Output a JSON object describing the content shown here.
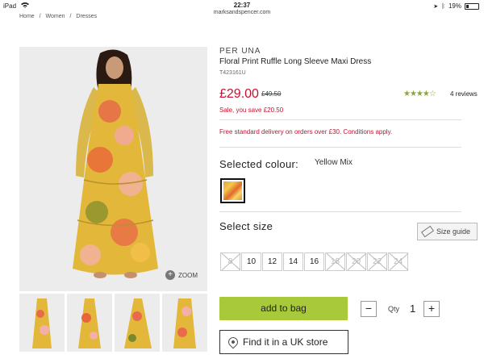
{
  "status_bar": {
    "device": "iPad",
    "time": "22:37",
    "url": "marksandspencer.com",
    "battery": "19%"
  },
  "breadcrumb": [
    "Home",
    "/",
    "Women",
    "/",
    "Dresses"
  ],
  "gallery": {
    "zoom_label": "ZOOM"
  },
  "product": {
    "brand": "PER UNA",
    "title": "Floral Print Ruffle Long Sleeve Maxi Dress",
    "code": "T423161U",
    "price": "£29.00",
    "was_price": "£49.50",
    "rating_stars": "★★★★☆",
    "rating": 4,
    "reviews": "4 reviews",
    "sale_text": "Sale, you save £20.50",
    "delivery_text": "Free standard delivery on orders over £30. Conditions apply."
  },
  "colour": {
    "label": "Selected colour:",
    "value": "Yellow Mix"
  },
  "size": {
    "label": "Select size",
    "guide_label": "Size guide",
    "options": [
      "8",
      "10",
      "12",
      "14",
      "16",
      "18",
      "20",
      "22",
      "24"
    ]
  },
  "actions": {
    "add_to_bag": "add to bag",
    "qty_label": "Qty",
    "qty_value": "1",
    "minus": "−",
    "plus": "+",
    "store_label": "Find it in a UK store"
  },
  "colors": {
    "sale_red": "#c8102e",
    "bag_green": "#a7c93a",
    "star_green": "#8aa53a"
  }
}
